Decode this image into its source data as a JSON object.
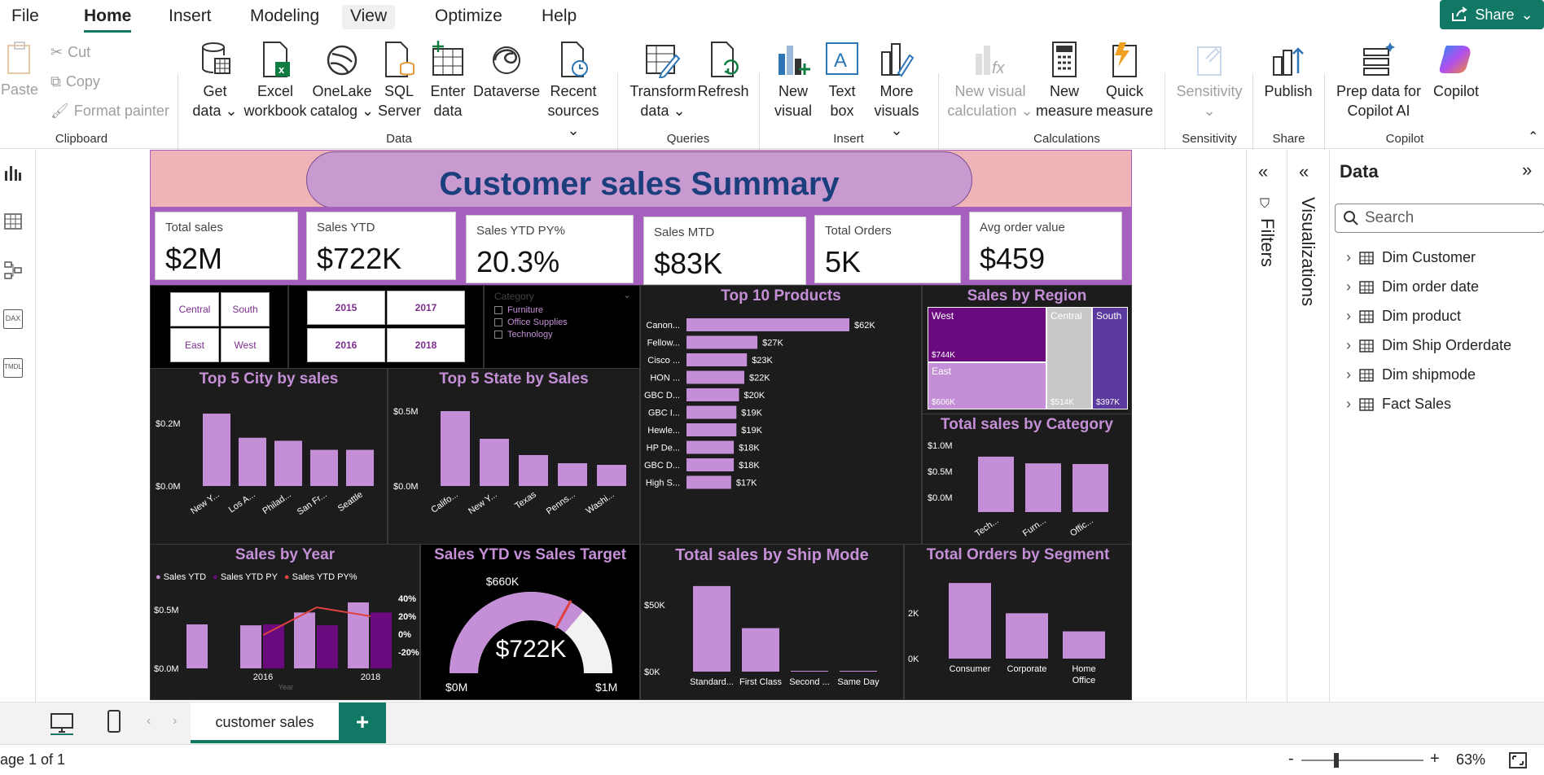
{
  "menu": {
    "tabs": [
      "File",
      "Home",
      "Insert",
      "Modeling",
      "View",
      "Optimize",
      "Help"
    ],
    "active": "Home",
    "share_label": "Share"
  },
  "ribbon": {
    "clipboard": {
      "paste": "Paste",
      "cut": "Cut",
      "copy": "Copy",
      "format_painter": "Format painter",
      "group": "Clipboard"
    },
    "data": {
      "get_data": "Get data",
      "excel": "Excel workbook",
      "onelake": "OneLake catalog",
      "sql": "SQL Server",
      "enter": "Enter data",
      "dataverse": "Dataverse",
      "recent": "Recent sources",
      "group": "Data"
    },
    "queries": {
      "transform": "Transform data",
      "refresh": "Refresh",
      "group": "Queries"
    },
    "insert": {
      "new_visual": "New visual",
      "text_box": "Text box",
      "more_visuals": "More visuals",
      "group": "Insert"
    },
    "calculations": {
      "new_visual_calc": "New visual calculation",
      "new_measure": "New measure",
      "quick_measure": "Quick measure",
      "group": "Calculations"
    },
    "sensitivity": {
      "label": "Sensitivity",
      "group": "Sensitivity"
    },
    "share": {
      "publish": "Publish",
      "group": "Share"
    },
    "copilot": {
      "prep": "Prep data for Copilot AI",
      "copilot": "Copilot",
      "group": "Copilot"
    }
  },
  "leftrail": {
    "items": [
      "Report view",
      "Table view",
      "Model view",
      "DAX query view",
      "TMDL view"
    ],
    "dax": "DAX",
    "tmdl": "TMDL"
  },
  "report": {
    "title": "Customer sales Summary",
    "kpis": [
      {
        "label": "Total sales",
        "value": "$2M"
      },
      {
        "label": "Sales YTD",
        "value": "$722K"
      },
      {
        "label": "Sales YTD PY%",
        "value": "20.3%"
      },
      {
        "label": "Sales MTD",
        "value": "$83K"
      },
      {
        "label": "Total Orders",
        "value": "5K"
      },
      {
        "label": "Avg order value",
        "value": "$459"
      }
    ],
    "region_slicer": [
      "Central",
      "South",
      "East",
      "West"
    ],
    "year_slicer": [
      "2015",
      "2017",
      "2016",
      "2018"
    ],
    "category_slicer": {
      "label": "Category",
      "items": [
        "Furniture",
        "Office Supplies",
        "Technology"
      ]
    },
    "top10": {
      "title": "Top 10 Products"
    },
    "region": {
      "title": "Sales by Region",
      "cells": [
        {
          "name": "West",
          "value": "$744K"
        },
        {
          "name": "Central",
          "value": "$514K"
        },
        {
          "name": "South",
          "value": "$397K"
        },
        {
          "name": "East",
          "value": "$606K"
        }
      ]
    },
    "city": {
      "title": "Top 5 City by sales"
    },
    "state": {
      "title": "Top 5 State by Sales"
    },
    "category": {
      "title": "Total sales by Category"
    },
    "year": {
      "title": "Sales by Year",
      "legend": [
        "Sales YTD",
        "Sales YTD PY",
        "Sales YTD PY%"
      ]
    },
    "gauge": {
      "title": "Sales YTD vs Sales Target",
      "value": "$722K",
      "target": "$660K",
      "min": "$0M",
      "max": "$1M"
    },
    "shipmode": {
      "title": "Total sales by Ship Mode"
    },
    "segment": {
      "title": "Total Orders by Segment"
    }
  },
  "chart_data": [
    {
      "type": "bar",
      "title": "Top 10 Products",
      "orientation": "horizontal",
      "categories": [
        "Canon...",
        "Fellow...",
        "Cisco ...",
        "HON ...",
        "GBC D...",
        "GBC I...",
        "Hewle...",
        "HP De...",
        "GBC D...",
        "High S..."
      ],
      "values": [
        62,
        27,
        23,
        22,
        20,
        19,
        19,
        18,
        18,
        17
      ],
      "labels": [
        "$62K",
        "$27K",
        "$23K",
        "$22K",
        "$20K",
        "$19K",
        "$19K",
        "$18K",
        "$18K",
        "$17K"
      ]
    },
    {
      "type": "bar",
      "title": "Top 5 City by sales",
      "categories": [
        "New Y...",
        "Los A...",
        "Philad...",
        "San Fr...",
        "Seattle"
      ],
      "values": [
        0.24,
        0.16,
        0.15,
        0.12,
        0.12
      ],
      "yticks": [
        "$0.2M",
        "$0.0M"
      ],
      "ylim": [
        0,
        0.27
      ]
    },
    {
      "type": "bar",
      "title": "Top 5 State by Sales",
      "categories": [
        "Califo...",
        "New Y...",
        "Texas",
        "Penns...",
        "Washi..."
      ],
      "values": [
        0.46,
        0.29,
        0.19,
        0.14,
        0.13
      ],
      "yticks": [
        "$0.5M",
        "$0.0M"
      ],
      "ylim": [
        0,
        0.55
      ]
    },
    {
      "type": "bar",
      "title": "Total sales by Category",
      "categories": [
        "Tech...",
        "Furn...",
        "Offic..."
      ],
      "values": [
        0.83,
        0.73,
        0.72
      ],
      "yticks": [
        "$1.0M",
        "$0.5M",
        "$0.0M"
      ],
      "ylim": [
        0,
        1.0
      ]
    },
    {
      "type": "bar",
      "title": "Sales by Year",
      "categories": [
        "2015",
        "2016",
        "2017",
        "2018"
      ],
      "series": [
        {
          "name": "Sales YTD",
          "values": [
            0.48,
            0.47,
            0.61,
            0.72
          ]
        },
        {
          "name": "Sales YTD PY",
          "values": [
            0,
            0.48,
            0.47,
            0.61
          ]
        },
        {
          "name": "Sales YTD PY%",
          "values": [
            null,
            -1,
            30,
            20
          ]
        }
      ],
      "xticks": [
        "2016",
        "2018"
      ],
      "xlabel": "Year",
      "yticks": [
        "$0.5M",
        "$0.0M"
      ],
      "y2ticks": [
        "40%",
        "20%",
        "0%",
        "-20%"
      ]
    },
    {
      "type": "bar",
      "title": "Total sales by Ship Mode",
      "categories": [
        "Standard...",
        "First Class",
        "Second ...",
        "Same Day"
      ],
      "values": [
        61,
        31,
        0.5,
        0.5
      ],
      "yticks": [
        "$50K",
        "$0K"
      ],
      "ylim": [
        0,
        65
      ]
    },
    {
      "type": "bar",
      "title": "Total Orders by Segment",
      "categories": [
        "Consumer",
        "Corporate",
        "Home Office"
      ],
      "values": [
        2.5,
        1.5,
        0.9
      ],
      "yticks": [
        "2K",
        "0K"
      ],
      "ylim": [
        0,
        2.8
      ]
    }
  ],
  "filters_label": "Filters",
  "viz_label": "Visualizations",
  "data_pane": {
    "title": "Data",
    "search_placeholder": "Search",
    "tables": [
      "Dim Customer",
      "Dim order date",
      "Dim product",
      "Dim Ship Orderdate",
      "Dim shipmode",
      "Fact Sales"
    ]
  },
  "pages": {
    "current": "customer sales",
    "add": "+"
  },
  "status": {
    "page": "age 1 of 1",
    "zoom": "63%",
    "zoom_minus": "-",
    "zoom_plus": "+"
  },
  "colors": {
    "accent": "#117865",
    "bar": "#c48fd6",
    "dark_purple": "#6a0a7e",
    "header_pink": "#eeb4b8",
    "band_purple": "#a65fbd"
  }
}
